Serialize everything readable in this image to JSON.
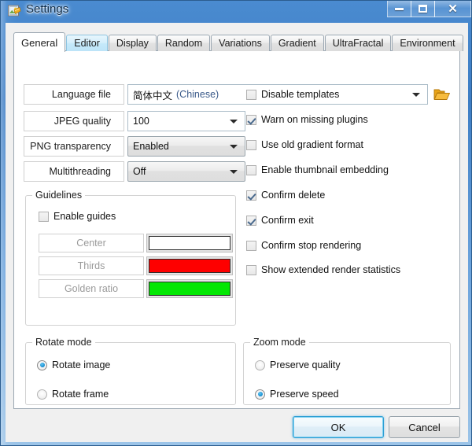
{
  "window": {
    "title": "Settings",
    "icon": "settings-picture-icon",
    "buttons": {
      "minimize": "minimize-icon",
      "maximize": "maximize-icon",
      "close": "close-icon"
    }
  },
  "tabs": [
    {
      "label": "General",
      "state": "active"
    },
    {
      "label": "Editor",
      "state": "hover"
    },
    {
      "label": "Display",
      "state": "normal"
    },
    {
      "label": "Random",
      "state": "normal"
    },
    {
      "label": "Variations",
      "state": "normal"
    },
    {
      "label": "Gradient",
      "state": "normal"
    },
    {
      "label": "UltraFractal",
      "state": "normal"
    },
    {
      "label": "Environment",
      "state": "normal"
    }
  ],
  "general": {
    "rows": [
      {
        "label": "Language file",
        "value": "简体中文",
        "value_suffix": "(Chinese)",
        "type": "editable-combo",
        "has_folder_button": true
      },
      {
        "label": "JPEG quality",
        "value": "100",
        "type": "editable-combo"
      },
      {
        "label": "PNG transparency",
        "value": "Enabled",
        "type": "dropdown"
      },
      {
        "label": "Multithreading",
        "value": "Off",
        "type": "dropdown"
      }
    ],
    "folder_icon": "open-folder-icon"
  },
  "guidelines": {
    "title": "Guidelines",
    "enable": {
      "label": "Enable guides",
      "checked": false
    },
    "items": [
      {
        "label": "Center",
        "color": "#ffffff",
        "disabled": true
      },
      {
        "label": "Thirds",
        "color": "#fe0000",
        "disabled": true
      },
      {
        "label": "Golden ratio",
        "color": "#03e703",
        "disabled": true
      }
    ]
  },
  "options": [
    {
      "label": "Disable templates",
      "checked": false
    },
    {
      "label": "Warn on missing plugins",
      "checked": true
    },
    {
      "label": "Use old gradient format",
      "checked": false
    },
    {
      "label": "Enable thumbnail embedding",
      "checked": false
    },
    {
      "label": "Confirm delete",
      "checked": true
    },
    {
      "label": "Confirm exit",
      "checked": true
    },
    {
      "label": "Confirm stop rendering",
      "checked": false
    },
    {
      "label": "Show extended render statistics",
      "checked": false
    }
  ],
  "rotate_mode": {
    "title": "Rotate mode",
    "options": [
      {
        "label": "Rotate image",
        "selected": true
      },
      {
        "label": "Rotate frame",
        "selected": false
      }
    ]
  },
  "zoom_mode": {
    "title": "Zoom mode",
    "options": [
      {
        "label": "Preserve quality",
        "selected": false
      },
      {
        "label": "Preserve speed",
        "selected": true
      }
    ]
  },
  "footer": {
    "ok": "OK",
    "cancel": "Cancel"
  }
}
